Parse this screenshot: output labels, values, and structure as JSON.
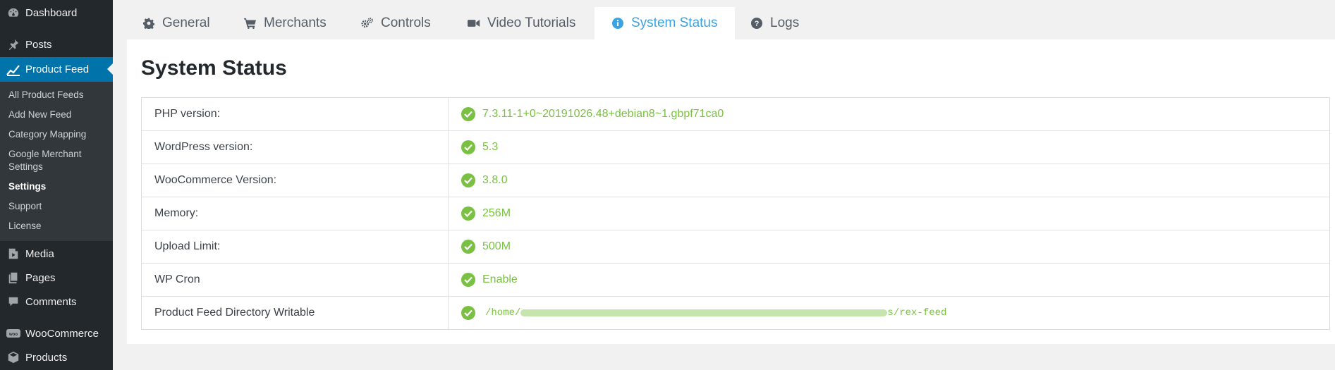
{
  "sidebar": {
    "items": [
      {
        "label": "Dashboard",
        "icon": "dashboard-icon"
      },
      {
        "label": "Posts",
        "icon": "pin-icon"
      },
      {
        "label": "Product Feed",
        "icon": "chart-line-icon"
      },
      {
        "label": "Media",
        "icon": "media-icon"
      },
      {
        "label": "Pages",
        "icon": "pages-icon"
      },
      {
        "label": "Comments",
        "icon": "comment-icon"
      },
      {
        "label": "WooCommerce",
        "icon": "woo-icon"
      },
      {
        "label": "Products",
        "icon": "box-icon"
      }
    ],
    "submenu": [
      {
        "label": "All Product Feeds"
      },
      {
        "label": "Add New Feed"
      },
      {
        "label": "Category Mapping"
      },
      {
        "label": "Google Merchant Settings"
      },
      {
        "label": "Settings"
      },
      {
        "label": "Support"
      },
      {
        "label": "License"
      }
    ]
  },
  "tabs": [
    {
      "label": "General",
      "icon": "gear-icon"
    },
    {
      "label": "Merchants",
      "icon": "cart-icon"
    },
    {
      "label": "Controls",
      "icon": "gears-icon"
    },
    {
      "label": "Video Tutorials",
      "icon": "video-camera-icon"
    },
    {
      "label": "System Status",
      "icon": "info-icon",
      "active": true
    },
    {
      "label": "Logs",
      "icon": "question-icon"
    }
  ],
  "page": {
    "title": "System Status"
  },
  "status_rows": [
    {
      "label": "PHP version:",
      "value": "7.3.11-1+0~20191026.48+debian8~1.gbpf71ca0"
    },
    {
      "label": "WordPress version:",
      "value": "5.3"
    },
    {
      "label": "WooCommerce Version:",
      "value": "3.8.0"
    },
    {
      "label": "Memory:",
      "value": "256M"
    },
    {
      "label": "Upload Limit:",
      "value": "500M"
    },
    {
      "label": "WP Cron",
      "value": "Enable"
    },
    {
      "label": "Product Feed Directory Writable",
      "value_prefix": "/home/",
      "value_suffix": "s/rex-feed"
    }
  ],
  "colors": {
    "accent": "#3aa3e3",
    "ok": "#7ac143",
    "sidebar": "#23282d",
    "current": "#0073aa"
  }
}
